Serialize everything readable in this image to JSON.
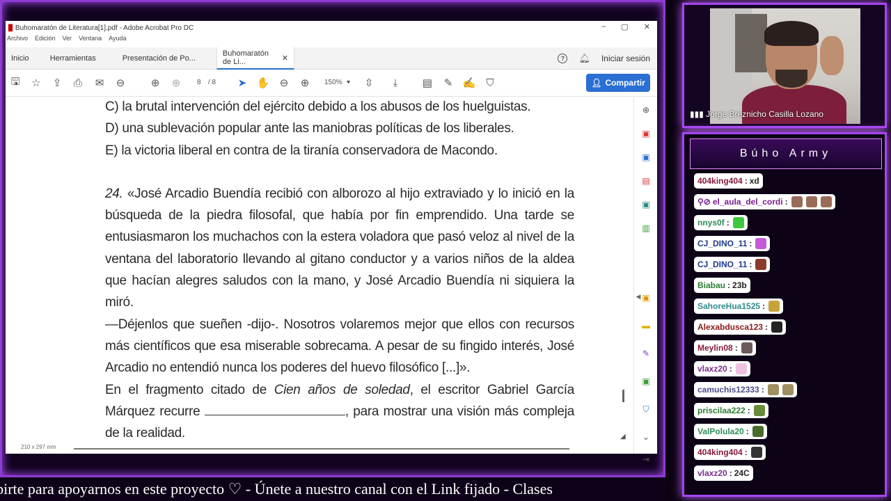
{
  "acrobat": {
    "window_title": "Buhomaratón de Literatura[1].pdf - Adobe Acrobat Pro DC",
    "window_controls": [
      "–",
      "▢",
      "✕"
    ],
    "menu": [
      "Archivo",
      "Edición",
      "Ver",
      "Ventana",
      "Ayuda"
    ],
    "tabs": [
      "Inicio",
      "Herramientas",
      "Presentación de Po...",
      "Buhomaratón de Li..."
    ],
    "active_tab_close": "✕",
    "help_icon_label": "?",
    "signin": "Iniciar sesión",
    "page_current": "8",
    "page_total": "/ 8",
    "zoom": "150%",
    "share": "Compartir",
    "page_size": "210 x 297 mm"
  },
  "document": {
    "option_c": "C) la brutal intervención del ejército debido a los abusos de los huelguistas.",
    "option_d": "D) una sublevación popular ante las maniobras políticas de los liberales.",
    "option_e": "E) la victoria liberal en contra de la tiranía conservadora de Macondo.",
    "q_number": "24.",
    "q_para1": " «José Arcadio Buendía recibió con alborozo al hijo extraviado y lo inició en la búsqueda de la piedra filosofal, que había por fin emprendido. Una tarde se entusiasmaron los muchachos con la estera voladora que pasó veloz al nivel de la ventana del laboratorio llevando al gitano conductor y a varios niños de la aldea que hacían alegres saludos con la mano, y José Arcadio Buendía ni siquiera la miró.",
    "q_para2": "—Déjenlos que sueñen -dijo-. Nosotros volaremos mejor que ellos con recursos más científicos que esa miserable sobrecama. A pesar de su fingido interés, José Arcadio no entendió nunca los poderes del huevo filosófico [...]».",
    "q_para3_a": "En el fragmento citado de ",
    "q_para3_title": "Cien años de soledad",
    "q_para3_b": ", el escritor Gabriel García Márquez recurre ",
    "q_para3_c": ", para mostrar una visión más compleja de la realidad."
  },
  "stream": {
    "ticker": "ibirte para apoyarnos en este proyecto  ♡   -   Únete a nuestro canal con el Link fijado  -  Clases",
    "camera_name": "Jorge Breznicho Casilla Lozano",
    "chat_title": "Búho Army"
  },
  "chat": [
    {
      "user": "404king404",
      "text": "xd",
      "color": "#8b1a3a",
      "emotes": []
    },
    {
      "user": "el_aula_del_cordi",
      "text": "",
      "color": "#7a1d8f",
      "emotes": [
        "#9b6b5a",
        "#9b6b5a",
        "#9b6b5a"
      ],
      "badges": true
    },
    {
      "user": "nnys0f",
      "text": "",
      "color": "#2e8b57",
      "emotes": [
        "#3fc83f"
      ]
    },
    {
      "user": "CJ_DINO_11",
      "text": "",
      "color": "#1e3a8a",
      "emotes": [
        "#c45ad8"
      ]
    },
    {
      "user": "CJ_DINO_11",
      "text": "",
      "color": "#1e3a8a",
      "emotes": [
        "#8a3b2a"
      ]
    },
    {
      "user": "Biabau",
      "text": "23b",
      "color": "#2e7d32",
      "emotes": []
    },
    {
      "user": "SahoreHua1525",
      "text": "",
      "color": "#2e8b8b",
      "emotes": [
        "#c8a23a"
      ]
    },
    {
      "user": "Alexabdusca123",
      "text": "",
      "color": "#8b1a1a",
      "emotes": [
        "#222222"
      ]
    },
    {
      "user": "Meylin08",
      "text": "",
      "color": "#8b1a3a",
      "emotes": [
        "#6a5a5a"
      ]
    },
    {
      "user": "vlaxz20",
      "text": "",
      "color": "#7a2d8f",
      "emotes": [
        "#f0c0e0"
      ]
    },
    {
      "user": "camuchis12333",
      "text": "",
      "color": "#4a4a8a",
      "emotes": [
        "#a09060",
        "#a09060"
      ]
    },
    {
      "user": "priscilaa222",
      "text": "",
      "color": "#2e7d32",
      "emotes": [
        "#6a8a3a"
      ]
    },
    {
      "user": "ValPolula20",
      "text": "",
      "color": "#2e8b57",
      "emotes": [
        "#4a6a2a"
      ]
    },
    {
      "user": "404king404",
      "text": "",
      "color": "#8b1a3a",
      "emotes": [
        "#333333"
      ]
    },
    {
      "user": "vlaxz20",
      "text": "24C",
      "color": "#7a2d8f",
      "emotes": []
    }
  ],
  "colors": {
    "accent": "#2a6fd3",
    "neon": "#a546f0"
  }
}
